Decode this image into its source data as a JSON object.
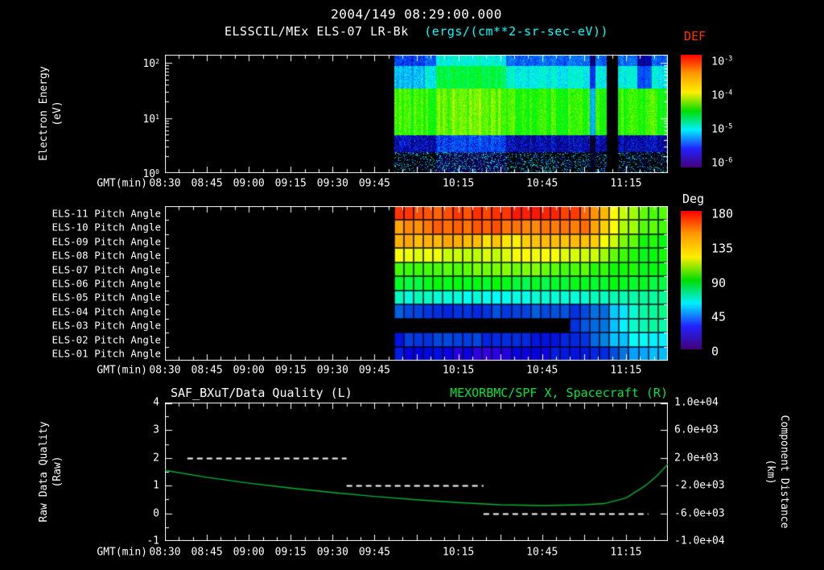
{
  "header": {
    "date_title": "2004/149 08:29:00.000",
    "instrument_title": "ELSSCIL/MEx ELS-07 LR-Bk",
    "units": "(ergs/(cm**2-sr-sec-eV))"
  },
  "colors": {
    "background": "#000000",
    "text": "#ffffff",
    "units_cyan": "#00ffff",
    "def_red": "#ff3300",
    "right_title_green": "#00e53c",
    "curve_green": "#00b437",
    "rainbow": [
      "#ff0000",
      "#ff9900",
      "#ffee00",
      "#00dd00",
      "#00eeff",
      "#2222ff",
      "#440077"
    ]
  },
  "time_axis": {
    "label": "GMT(min)",
    "start": "08:30",
    "end": "11:30",
    "ticks": [
      {
        "label": "08:30",
        "min": 0
      },
      {
        "label": "08:45",
        "min": 15
      },
      {
        "label": "09:00",
        "min": 30
      },
      {
        "label": "09:15",
        "min": 45
      },
      {
        "label": "09:30",
        "min": 60
      },
      {
        "label": "09:45",
        "min": 75
      },
      {
        "label": "10:15",
        "min": 105
      },
      {
        "label": "10:45",
        "min": 135
      },
      {
        "label": "11:15",
        "min": 165
      }
    ]
  },
  "spectrogram": {
    "ylabel_lines": [
      "Electron Energy",
      "(eV)"
    ],
    "yscale": "log",
    "y_tick_exponents": [
      2,
      1,
      0
    ],
    "data_start": "09:52",
    "colorbar": {
      "label": "DEF",
      "tick_exponents": [
        -3,
        -4,
        -5,
        -6
      ]
    }
  },
  "pitch": {
    "rows": [
      "ELS-11 Pitch Angle",
      "ELS-10 Pitch Angle",
      "ELS-09 Pitch Angle",
      "ELS-08 Pitch Angle",
      "ELS-07 Pitch Angle",
      "ELS-06 Pitch Angle",
      "ELS-05 Pitch Angle",
      "ELS-04 Pitch Angle",
      "ELS-03 Pitch Angle",
      "ELS-02 Pitch Angle",
      "ELS-01 Pitch Angle"
    ],
    "colorbar": {
      "label": "Deg",
      "ticks": [
        180,
        135,
        90,
        45,
        0
      ]
    }
  },
  "quality_panel": {
    "left_title": "SAF_BXuT/Data Quality (L)",
    "right_title": "MEXORBMC/SPF X, Spacecraft (R)",
    "left_axis": {
      "lines": [
        "Raw Data Quality",
        "(Raw)"
      ],
      "ticks": [
        4,
        3,
        2,
        1,
        0,
        -1
      ]
    },
    "right_axis": {
      "lines": [
        "Component Distance",
        "(km)"
      ],
      "ticks": [
        "1.0e+04",
        "6.0e+03",
        "2.0e+03",
        "-2.0e+03",
        "-6.0e+03",
        "-1.0e+04"
      ]
    }
  },
  "chart_data": [
    {
      "type": "heatmap",
      "panel": "electron-spectrogram",
      "title": "ELSSCIL/MEx ELS-07 LR-Bk",
      "zlabel": "DEF (ergs/(cm**2-sr-sec-eV))",
      "zlim_log10": [
        -6,
        -3
      ],
      "ylabel": "Electron Energy (eV)",
      "yscale": "log",
      "ylim": [
        1,
        140
      ],
      "x_range": [
        "08:30",
        "11:30"
      ],
      "data_start": "09:52",
      "energy_bands": [
        {
          "range_eV": [
            1,
            2.4
          ],
          "v": 0.05,
          "speckle": true
        },
        {
          "range_eV": [
            2.4,
            5
          ],
          "v": 0.13
        },
        {
          "range_eV": [
            5,
            35
          ],
          "v": 0.6
        },
        {
          "range_eV": [
            35,
            90
          ],
          "v": 0.36
        },
        {
          "range_eV": [
            90,
            141
          ],
          "v": 0.22
        }
      ],
      "features": [
        {
          "t": [
            "09:52",
            "10:03"
          ],
          "factor": 0.8,
          "band": "high",
          "desc": "dimmer high energies at data start"
        },
        {
          "t": [
            "10:07",
            "10:32"
          ],
          "factor": 1.2,
          "band": "high",
          "desc": "enhanced flux extending to high energies"
        },
        {
          "t": [
            "11:02",
            "11:04"
          ],
          "factor": 0.45,
          "band": "all",
          "desc": "brief partial dropout"
        },
        {
          "t": [
            "11:08",
            "11:12"
          ],
          "factor": 0.05,
          "band": "all",
          "desc": "data gap (black column)"
        },
        {
          "t": [
            "11:19",
            "11:24"
          ],
          "factor": 0.55,
          "band": "high",
          "desc": "high-energy dropout near end"
        }
      ]
    },
    {
      "type": "heatmap",
      "panel": "pitch-angle",
      "rows": [
        "ELS-11",
        "ELS-10",
        "ELS-09",
        "ELS-08",
        "ELS-07",
        "ELS-06",
        "ELS-05",
        "ELS-04",
        "ELS-03",
        "ELS-02",
        "ELS-01"
      ],
      "zlabel": "Deg",
      "zlim": [
        0,
        180
      ],
      "data_start": "09:52",
      "deg_main": [
        172,
        162,
        150,
        135,
        115,
        95,
        65,
        32,
        35,
        28,
        18
      ],
      "deg_end": [
        112,
        108,
        104,
        100,
        96,
        90,
        82,
        75,
        68,
        62,
        55
      ],
      "transition": [
        "11:00",
        "11:22"
      ],
      "gap": {
        "row": "ELS-03",
        "row_index": 8,
        "until": "10:56"
      }
    },
    {
      "type": "line",
      "xlabel": "GMT(min)",
      "x_minutes_after_0830": [
        0,
        15,
        30,
        45,
        60,
        75,
        90,
        105,
        120,
        135,
        150,
        157,
        165,
        172,
        176,
        180
      ],
      "series": [
        {
          "name": "SAF_BXuT/Data Quality (L)",
          "axis": "left",
          "color": "#ffffff",
          "style": "dashed",
          "segments": [
            {
              "t_min": [
                8,
                65
              ],
              "value": 2
            },
            {
              "t_min": [
                65,
                114
              ],
              "value": 1
            },
            {
              "t_min": [
                114,
                173
              ],
              "value": 0
            }
          ]
        },
        {
          "name": "MEXORBMC/SPF X, Spacecraft (R)",
          "axis": "right",
          "color": "#00b437",
          "style": "solid",
          "values_km": [
            200,
            -800,
            -1640,
            -2360,
            -3000,
            -3560,
            -4040,
            -4440,
            -4760,
            -4880,
            -4760,
            -4600,
            -3800,
            -2000,
            -600,
            1120
          ]
        }
      ],
      "left_axis": {
        "label": "Raw Data Quality (Raw)",
        "ylim": [
          -1,
          4
        ],
        "ticks": [
          4,
          3,
          2,
          1,
          0,
          -1
        ]
      },
      "right_axis": {
        "label": "Component Distance (km)",
        "ylim": [
          -10000,
          10000
        ],
        "ticks": [
          10000,
          6000,
          2000,
          -2000,
          -6000,
          -10000
        ]
      }
    }
  ]
}
